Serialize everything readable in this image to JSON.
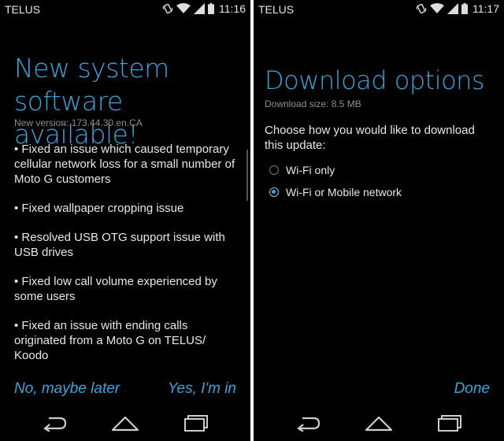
{
  "left": {
    "status": {
      "carrier": "TELUS",
      "time": "11:16"
    },
    "title": "New system software available!",
    "version": "New version: 173.44.30.en.CA",
    "notes": [
      "• Fixed an issue which caused temporary cellular network loss for a small number of Moto G customers",
      "• Fixed wallpaper cropping issue",
      "• Resolved USB OTG support issue with USB drives",
      "• Fixed low call volume experienced by some users",
      "• Fixed an issue with ending calls originated from a Moto G on TELUS/ Koodo"
    ],
    "buttons": {
      "later": "No, maybe later",
      "yes": "Yes, I'm in"
    }
  },
  "right": {
    "status": {
      "carrier": "TELUS",
      "time": "11:17"
    },
    "title": "Download options",
    "size": "Download size: 8.5 MB",
    "question": "Choose how you would like to download this update:",
    "options": [
      {
        "label": "Wi-Fi only",
        "selected": false
      },
      {
        "label": "Wi-Fi or Mobile network",
        "selected": true
      }
    ],
    "done": "Done"
  },
  "colors": {
    "accent": "#35a6dd",
    "background": "#000000",
    "text": "#e8e8e8"
  },
  "icons": [
    "vibrate-icon",
    "wifi-icon",
    "signal-icon",
    "battery-icon",
    "back-icon",
    "home-icon",
    "recents-icon"
  ]
}
